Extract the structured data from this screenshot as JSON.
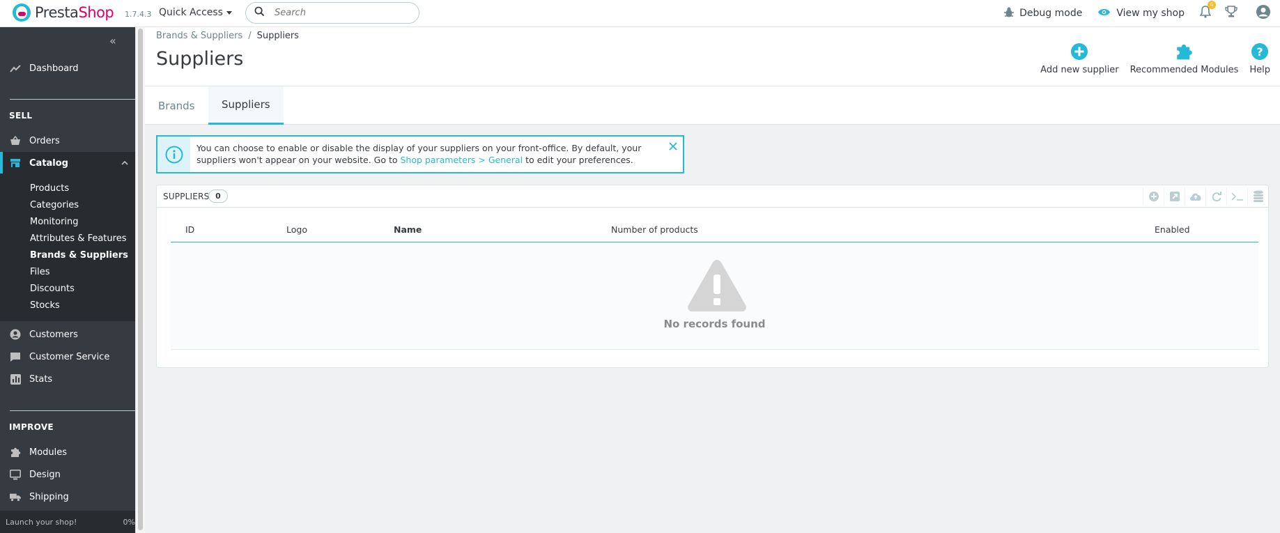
{
  "header": {
    "logo_brand_a": "Presta",
    "logo_brand_b": "Shop",
    "version": "1.7.4.3",
    "quick_access": "Quick Access",
    "search_placeholder": "Search",
    "debug_mode": "Debug mode",
    "view_shop": "View my shop",
    "notifications_count": "6"
  },
  "sidebar": {
    "dashboard": "Dashboard",
    "sell_title": "SELL",
    "orders": "Orders",
    "catalog": "Catalog",
    "catalog_items": [
      "Products",
      "Categories",
      "Monitoring",
      "Attributes & Features",
      "Brands & Suppliers",
      "Files",
      "Discounts",
      "Stocks"
    ],
    "customers": "Customers",
    "customer_service": "Customer Service",
    "stats": "Stats",
    "improve_title": "IMPROVE",
    "modules": "Modules",
    "design": "Design",
    "shipping": "Shipping",
    "launch": "Launch your shop!",
    "launch_pct": "0%"
  },
  "page": {
    "breadcrumb_parent": "Brands & Suppliers",
    "breadcrumb_sep": "/",
    "breadcrumb_current": "Suppliers",
    "title": "Suppliers",
    "toolbar": {
      "add_supplier": "Add new supplier",
      "recommended": "Recommended Modules",
      "help": "Help"
    }
  },
  "tabs": [
    "Brands",
    "Suppliers"
  ],
  "alert": {
    "text_before": "You can choose to enable or disable the display of your suppliers on your front-office. By default, your suppliers won't appear on your website. Go to ",
    "link": "Shop parameters > General",
    "text_after": " to edit your preferences."
  },
  "panel": {
    "title": "SUPPLIERS",
    "count": "0",
    "columns": [
      "ID",
      "Logo",
      "Name",
      "Number of products",
      "Enabled"
    ],
    "empty_text": "No records found"
  },
  "colors": {
    "accent": "#25b9d7",
    "brand_pink": "#df0067",
    "sidebar_bg": "#363a41"
  }
}
